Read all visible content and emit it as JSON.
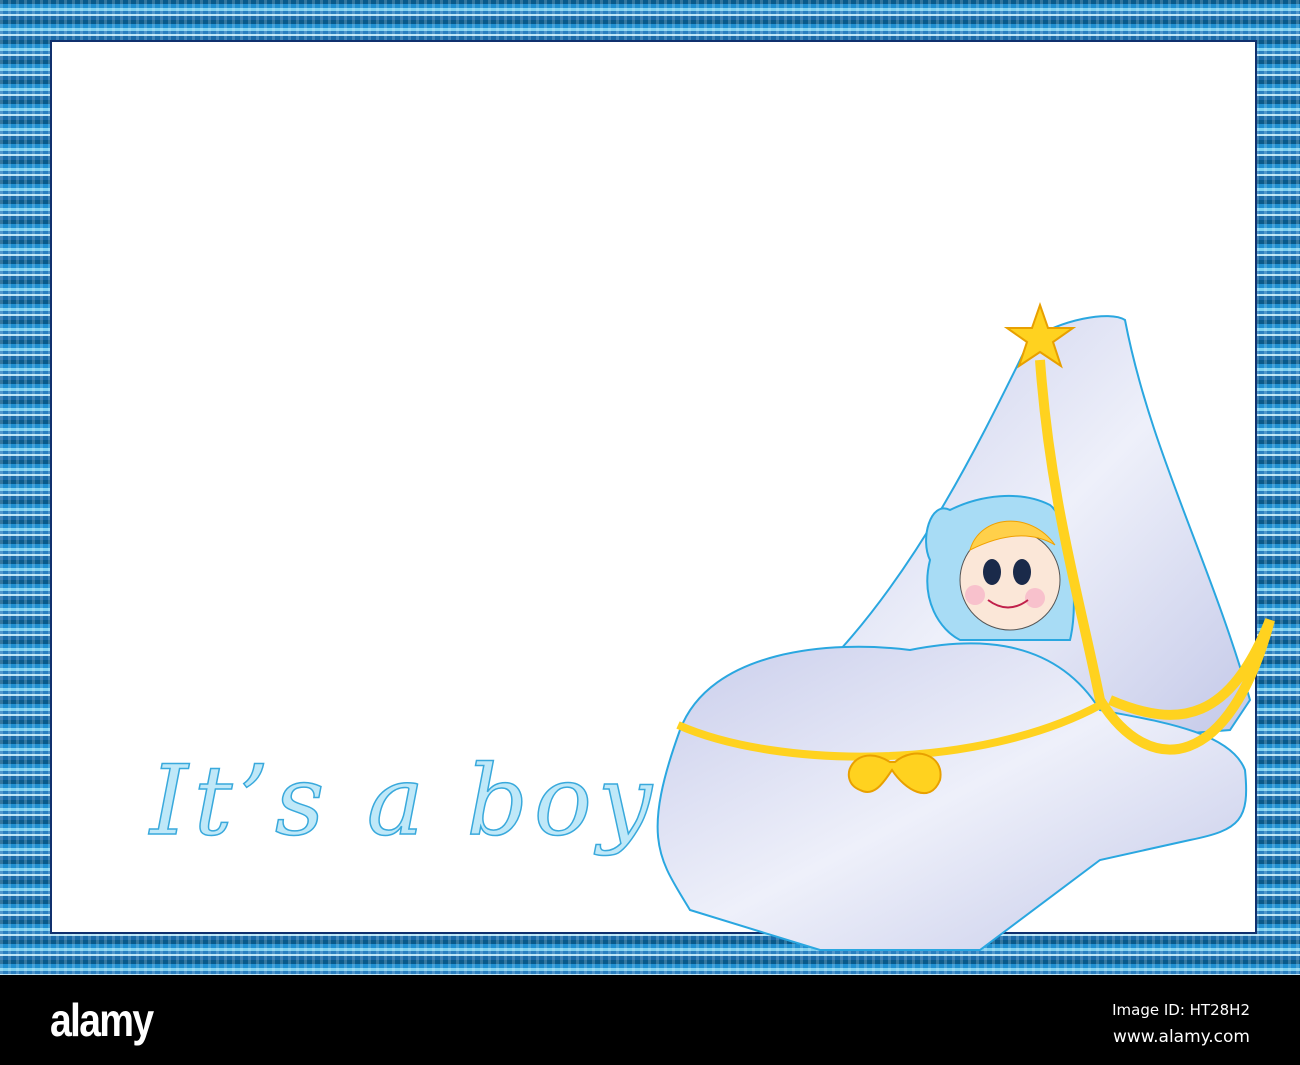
{
  "card": {
    "headline": "It’s a boy"
  },
  "footer": {
    "logo": "alamy",
    "image_id": "Image ID: HT28H2",
    "website": "www.alamy.com"
  },
  "colors": {
    "frame_blue": "#1f8fd0",
    "cradle": "#d8dcf0",
    "ribbon": "#ffd21f",
    "outline": "#2aa7e0"
  }
}
